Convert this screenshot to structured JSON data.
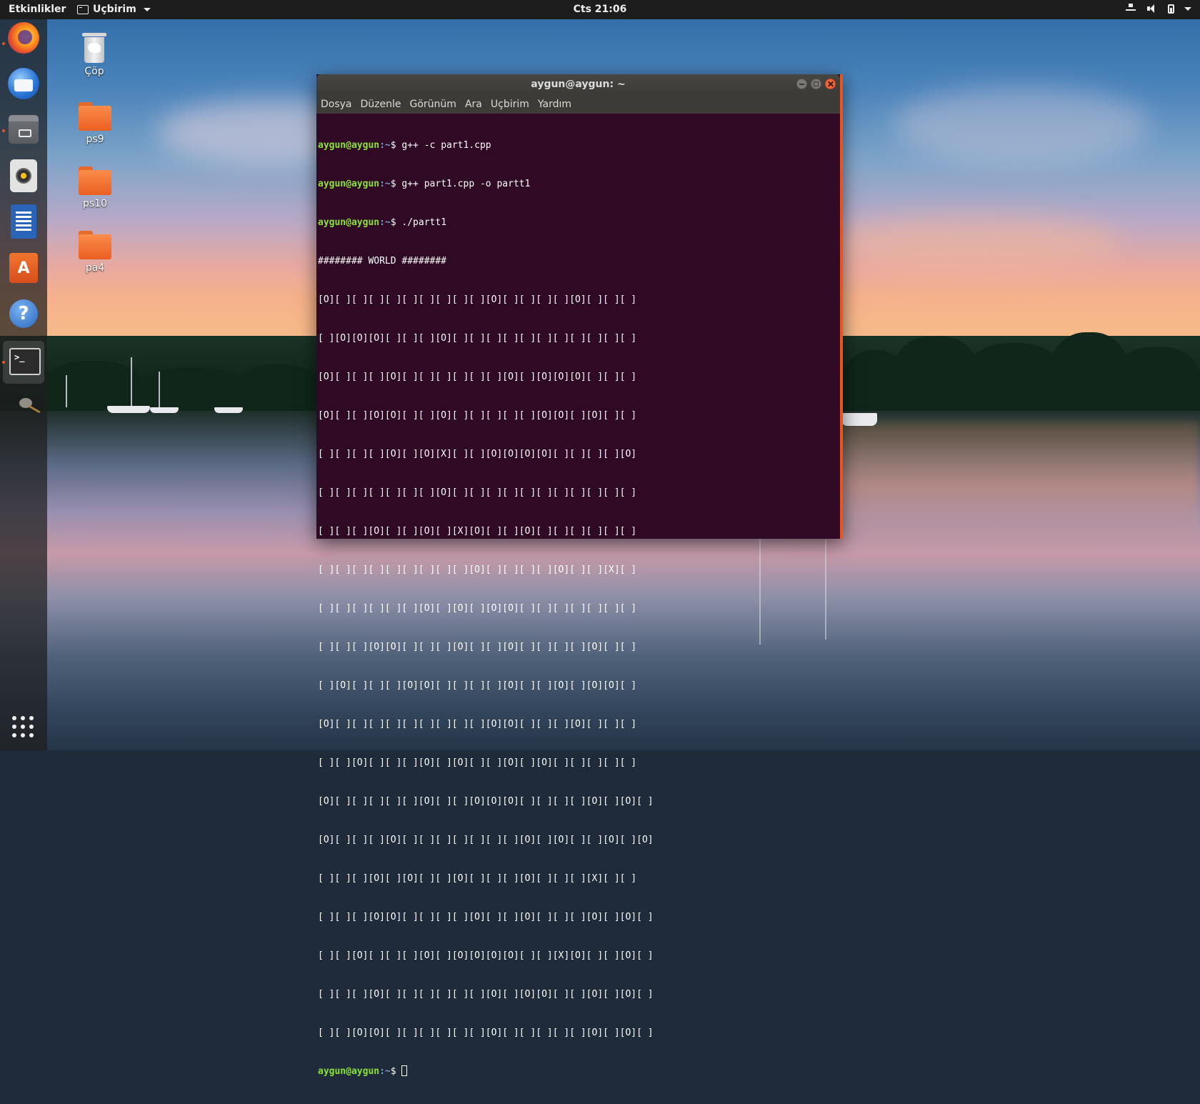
{
  "topbar": {
    "activities": "Etkinlikler",
    "app_menu": "Uçbirim",
    "clock": "Cts 21:06",
    "tray_icons": [
      "network-icon",
      "volume-icon",
      "battery-icon",
      "chevron-down-icon"
    ]
  },
  "dock": {
    "apps": [
      "firefox-icon",
      "thunderbird-icon",
      "files-icon",
      "rhythmbox-icon",
      "libreoffice-writer-icon",
      "ubuntu-software-icon",
      "help-icon",
      "terminal-icon",
      "gimp-icon"
    ],
    "software_glyph": "A",
    "help_glyph": "?",
    "terminal_glyph": ">_",
    "show_apps": "show-applications-icon"
  },
  "desktop": {
    "trash_label": "Çöp",
    "folder1_label": "ps9",
    "folder2_label": "ps10",
    "folder3_label": "pa4"
  },
  "terminal": {
    "title": "aygun@aygun: ~",
    "menu": {
      "file": "Dosya",
      "edit": "Düzenle",
      "view": "Görünüm",
      "search": "Ara",
      "terminal": "Uçbirim",
      "help": "Yardım"
    },
    "prompt_user": "aygun@aygun",
    "prompt_path": ":~",
    "prompt_symbol": "$ ",
    "commands": [
      "g++ -c part1.cpp",
      "g++ part1.cpp -o partt1",
      "./partt1"
    ],
    "output": [
      "######## WORLD ########",
      "[O][ ][ ][ ][ ][ ][ ][ ][ ][ ][O][ ][ ][ ][ ][O][ ][ ][ ]",
      "[ ][O][O][O][ ][ ][ ][O][ ][ ][ ][ ][ ][ ][ ][ ][ ][ ][ ]",
      "[O][ ][ ][ ][O][ ][ ][ ][ ][ ][ ][O][ ][O][O][O][ ][ ][ ]",
      "[O][ ][ ][O][O][ ][ ][O][ ][ ][ ][ ][ ][O][O][ ][O][ ][ ]",
      "[ ][ ][ ][ ][O][ ][O][X][ ][ ][O][O][O][O][ ][ ][ ][ ][O]",
      "[ ][ ][ ][ ][ ][ ][ ][O][ ][ ][ ][ ][ ][ ][ ][ ][ ][ ][ ]",
      "[ ][ ][ ][O][ ][ ][O][ ][X][O][ ][ ][O][ ][ ][ ][ ][ ][ ]",
      "[ ][ ][ ][ ][ ][ ][ ][ ][ ][O][ ][ ][ ][ ][O][ ][ ][X][ ]",
      "[ ][ ][ ][ ][ ][ ][O][ ][O][ ][O][O][ ][ ][ ][ ][ ][ ][ ]",
      "[ ][ ][ ][O][O][ ][ ][ ][O][ ][ ][O][ ][ ][ ][ ][O][ ][ ]",
      "[ ][O][ ][ ][ ][O][O][ ][ ][ ][ ][O][ ][ ][O][ ][O][O][ ]",
      "[O][ ][ ][ ][ ][ ][ ][ ][ ][ ][O][O][ ][ ][ ][O][ ][ ][ ]",
      "[ ][ ][O][ ][ ][ ][O][ ][O][ ][ ][O][ ][O][ ][ ][ ][ ][ ]",
      "[O][ ][ ][ ][ ][ ][O][ ][ ][O][O][O][ ][ ][ ][ ][O][ ][O][ ]",
      "[O][ ][ ][ ][O][ ][ ][ ][ ][ ][ ][ ][O][ ][O][ ][ ][O][ ][O]",
      "[ ][ ][ ][O][ ][O][ ][ ][O][ ][ ][ ][O][ ][ ][ ][X][ ][ ]",
      "[ ][ ][ ][O][O][ ][ ][ ][ ][O][ ][ ][O][ ][ ][ ][O][ ][O][ ]",
      "[ ][ ][O][ ][ ][ ][O][ ][O][O][O][O][ ][ ][X][O][ ][ ][O][ ]",
      "[ ][ ][ ][O][ ][ ][ ][ ][ ][ ][O][ ][O][O][ ][ ][O][ ][O][ ]",
      "[ ][ ][O][O][ ][ ][ ][ ][ ][ ][O][ ][ ][ ][ ][ ][O][ ][O][ ]"
    ]
  }
}
